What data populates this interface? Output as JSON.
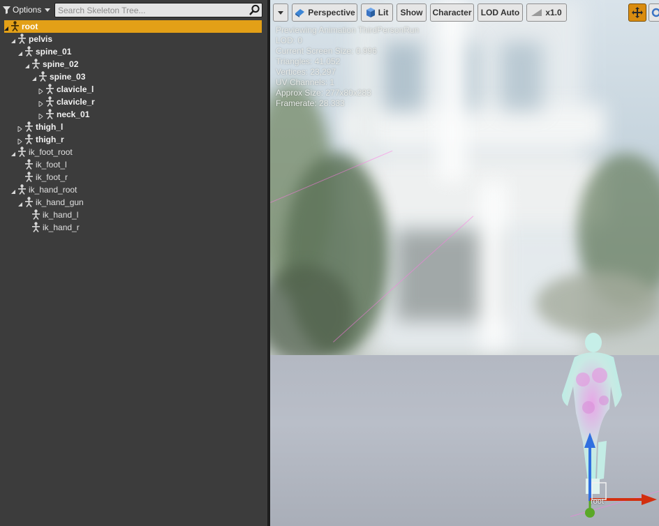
{
  "left_panel": {
    "options_label": "Options",
    "search_placeholder": "Search Skeleton Tree...",
    "bones": [
      {
        "label": "root",
        "depth": 0,
        "bold": true,
        "expander": "expanded",
        "selected": true
      },
      {
        "label": "pelvis",
        "depth": 1,
        "bold": true,
        "expander": "expanded"
      },
      {
        "label": "spine_01",
        "depth": 2,
        "bold": true,
        "expander": "expanded"
      },
      {
        "label": "spine_02",
        "depth": 3,
        "bold": true,
        "expander": "expanded"
      },
      {
        "label": "spine_03",
        "depth": 4,
        "bold": true,
        "expander": "expanded"
      },
      {
        "label": "clavicle_l",
        "depth": 5,
        "bold": true,
        "expander": "collapsed"
      },
      {
        "label": "clavicle_r",
        "depth": 5,
        "bold": true,
        "expander": "collapsed"
      },
      {
        "label": "neck_01",
        "depth": 5,
        "bold": true,
        "expander": "collapsed"
      },
      {
        "label": "thigh_l",
        "depth": 2,
        "bold": true,
        "expander": "collapsed"
      },
      {
        "label": "thigh_r",
        "depth": 2,
        "bold": true,
        "expander": "collapsed"
      },
      {
        "label": "ik_foot_root",
        "depth": 1,
        "bold": false,
        "expander": "expanded"
      },
      {
        "label": "ik_foot_l",
        "depth": 2,
        "bold": false,
        "expander": "none"
      },
      {
        "label": "ik_foot_r",
        "depth": 2,
        "bold": false,
        "expander": "none"
      },
      {
        "label": "ik_hand_root",
        "depth": 1,
        "bold": false,
        "expander": "expanded"
      },
      {
        "label": "ik_hand_gun",
        "depth": 2,
        "bold": false,
        "expander": "expanded"
      },
      {
        "label": "ik_hand_l",
        "depth": 3,
        "bold": false,
        "expander": "none"
      },
      {
        "label": "ik_hand_r",
        "depth": 3,
        "bold": false,
        "expander": "none"
      }
    ]
  },
  "viewport": {
    "toolbar": {
      "perspective": "Perspective",
      "lit": "Lit",
      "show": "Show",
      "character": "Character",
      "lod": "LOD Auto",
      "speed": "x1.0"
    },
    "stats": [
      "Previewing Animation ThirdPersonRun",
      "LOD: 0",
      "Current Screen Size: 0.996",
      "Triangles: 41,052",
      "Vertices: 23,297",
      "UV Channels: 1",
      "Approx Size: 277x80x283",
      "Framerate: 28.333"
    ],
    "root_label": "root"
  },
  "colors": {
    "selection": "#e3a017",
    "panel_bg": "#3c3c3c",
    "gizmo_x": "#d22f0f",
    "gizmo_y": "#2f6fe0",
    "gizmo_z": "#5aa827"
  }
}
